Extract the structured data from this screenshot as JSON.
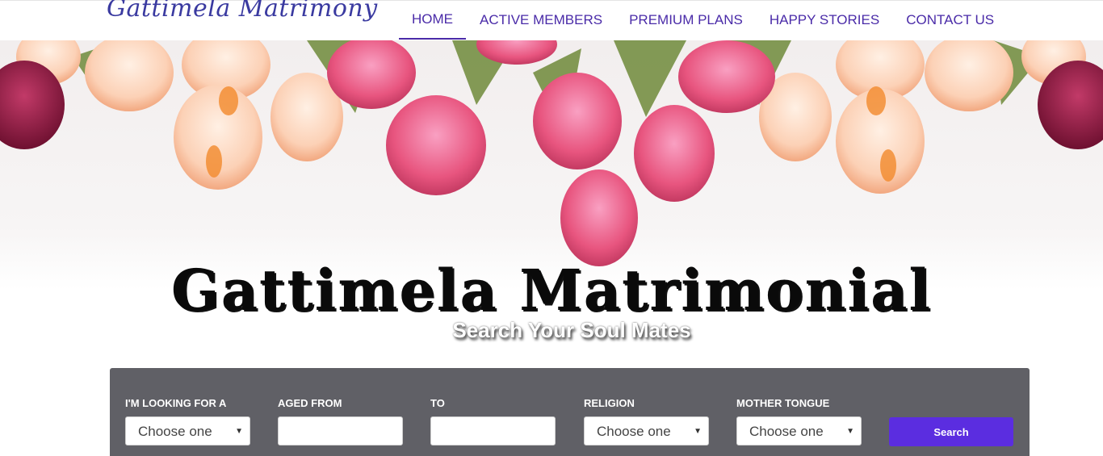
{
  "header": {
    "logo": "Gattimela Matrimony",
    "nav": [
      {
        "label": "HOME",
        "active": true
      },
      {
        "label": "ACTIVE MEMBERS",
        "active": false
      },
      {
        "label": "PREMIUM PLANS",
        "active": false
      },
      {
        "label": "HAPPY STORIES",
        "active": false
      },
      {
        "label": "CONTACT US",
        "active": false
      }
    ]
  },
  "hero": {
    "title": "Gattimela Matrimonial",
    "subtitle": "Search Your Soul Mates"
  },
  "search": {
    "looking_for": {
      "label": "I'M LOOKING FOR A",
      "value": "Choose one"
    },
    "aged_from": {
      "label": "AGED FROM",
      "value": ""
    },
    "aged_to": {
      "label": "TO",
      "value": ""
    },
    "religion": {
      "label": "RELIGION",
      "value": "Choose one"
    },
    "mother_tongue": {
      "label": "MOTHER TONGUE",
      "value": "Choose one"
    },
    "button_label": "Search"
  },
  "colors": {
    "accent": "#5b2de0",
    "nav_text": "#4a2ba8",
    "panel_bg": "#606066"
  }
}
